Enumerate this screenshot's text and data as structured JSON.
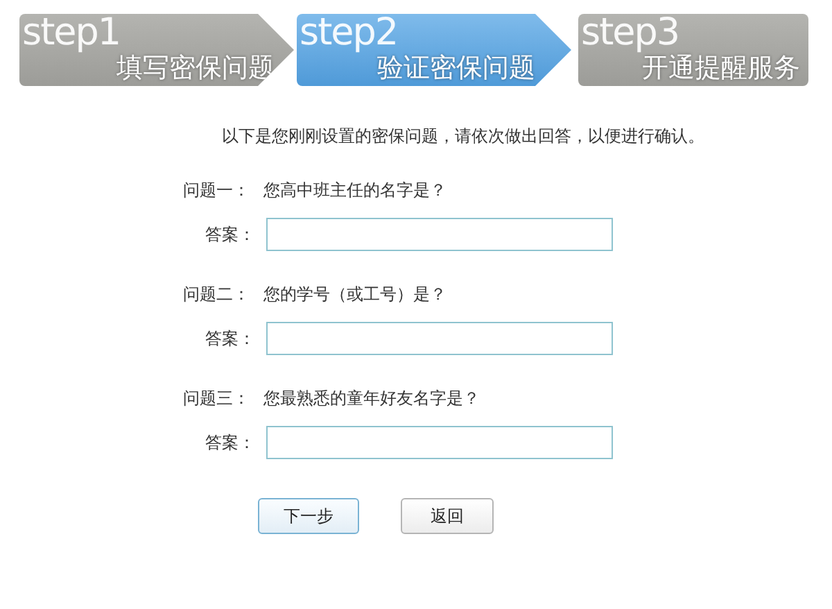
{
  "steps": [
    {
      "kind": "arrow",
      "step": "step1",
      "label": "填写密保问题",
      "selected": false
    },
    {
      "kind": "arrow",
      "step": "step2",
      "label": "验证密保问题",
      "selected": true
    },
    {
      "kind": "end",
      "step": "step3",
      "label": "开通提醒服务",
      "selected": false
    }
  ],
  "intro": "以下是您刚刚设置的密保问题，请依次做出回答，以便进行确认。",
  "questions": [
    {
      "label": "问题一：",
      "question": "您高中班主任的名字是？",
      "answer_label": "答案："
    },
    {
      "label": "问题二：",
      "question": "您的学号（或工号）是？",
      "answer_label": "答案："
    },
    {
      "label": "问题三：",
      "question": "您最熟悉的童年好友名字是？",
      "answer_label": "答案："
    }
  ],
  "buttons": [
    {
      "kind": "primary",
      "label": "下一步"
    },
    {
      "kind": "secondary",
      "label": "返回"
    }
  ]
}
